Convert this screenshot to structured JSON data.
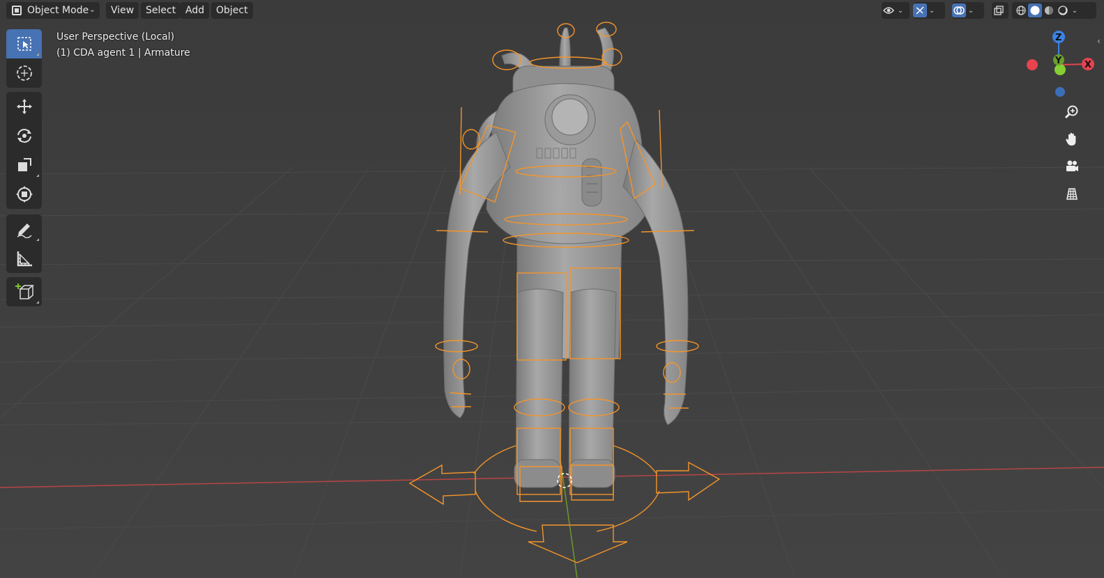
{
  "header": {
    "mode": "Object Mode",
    "menus": [
      "View",
      "Select",
      "Add",
      "Object"
    ],
    "right_icons": [
      "visibility-icon",
      "gizmo-icon",
      "overlay-icon",
      "xray-icon",
      "wireframe-shading-icon",
      "solid-shading-icon",
      "material-shading-icon",
      "rendered-shading-icon"
    ]
  },
  "viewport_info": {
    "perspective": "User Perspective (Local)",
    "object": "(1) CDA agent 1 | Armature"
  },
  "toolbar": {
    "tools": [
      "select-box",
      "cursor",
      "move",
      "rotate",
      "scale",
      "transform",
      "annotate",
      "measure",
      "add-cube"
    ],
    "active": "select-box"
  },
  "gizmo": {
    "x": "X",
    "y": "Y",
    "z": "Z"
  },
  "nav_buttons": [
    "zoom-icon",
    "pan-hand-icon",
    "camera-icon",
    "ortho-grid-icon"
  ],
  "colors": {
    "accent": "#4772b3",
    "armature": "#f5952a",
    "x_axis": "#e6434f",
    "y_axis": "#7fc52f",
    "z_axis": "#3c82e6"
  }
}
